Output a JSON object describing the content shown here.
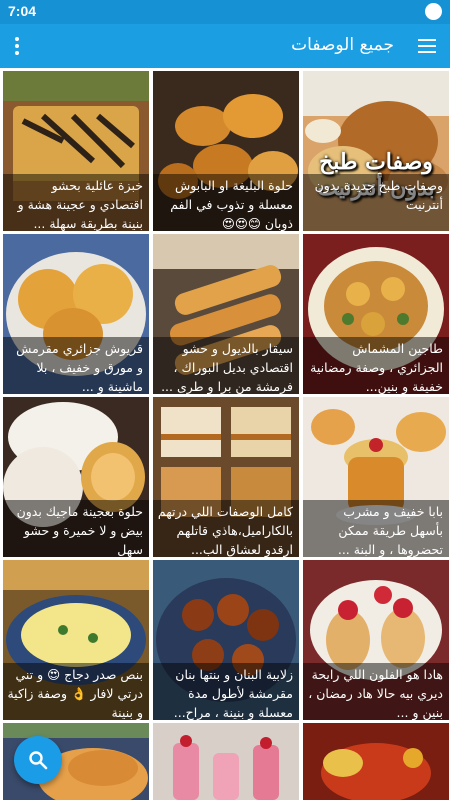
{
  "status_bar": {
    "time": "7:04"
  },
  "app_bar": {
    "title": "جميع الوصفات"
  },
  "colors": {
    "primary": "#1c9ee2",
    "status_bar": "#1591d4",
    "fab": "#1b9ce6"
  },
  "icons": {
    "menu": "hamburger-menu-icon",
    "overflow": "more-vert-icon",
    "fab": "search-icon"
  },
  "recipes": [
    {
      "caption": "وصفات طبخ جديدة بدون أنترنيت",
      "badge": "وصفات طبخ بدون أنترنيت"
    },
    {
      "caption": "حلوة البليغة او البابوش معسلة و تذوب في الفم ذوبان 😊😍😍"
    },
    {
      "caption": "خبزة عائلية بحشو اقتصادي و عجينة هشة و بنينة بطريقة سهلة ..."
    },
    {
      "caption": "طاجين المشماش الجزائري ، وصفة رمضانية خفيفة و بنين..."
    },
    {
      "caption": "سيقار بالديول و حشو اقتصادي بديل البوراك ، فرمشة من برا و طرى ..."
    },
    {
      "caption": "قريوش جزائري مقرمش و مورق و خفيف ، بلا ماشينة و ..."
    },
    {
      "caption": "بابا خفيف و مشرب بأسهل طريقة ممكن تحضروها ، و البنة ..."
    },
    {
      "caption": "كامل الوصفات اللي درتهم بالكاراميل،هاذي قاتلهم ارقدو لعشاق الب..."
    },
    {
      "caption": "حلوة بعجينة ماجيك بدون بيض و لا خميرة و حشو سهل"
    },
    {
      "caption": "هادا هو الفلون اللي رايحة ديري بيه حالا هاد رمضان ، بنين و ..."
    },
    {
      "caption": "زلابية البنان و بنتها بنان مقرمشة لأطول مدة معسلة و بنينة ، مراح..."
    },
    {
      "caption": "بنص صدر دجاج 😍 و تني درتي لافار 👌 وصفة زاكية و بنينة"
    },
    {
      "caption": ""
    },
    {
      "caption": ""
    },
    {
      "caption": ""
    }
  ]
}
